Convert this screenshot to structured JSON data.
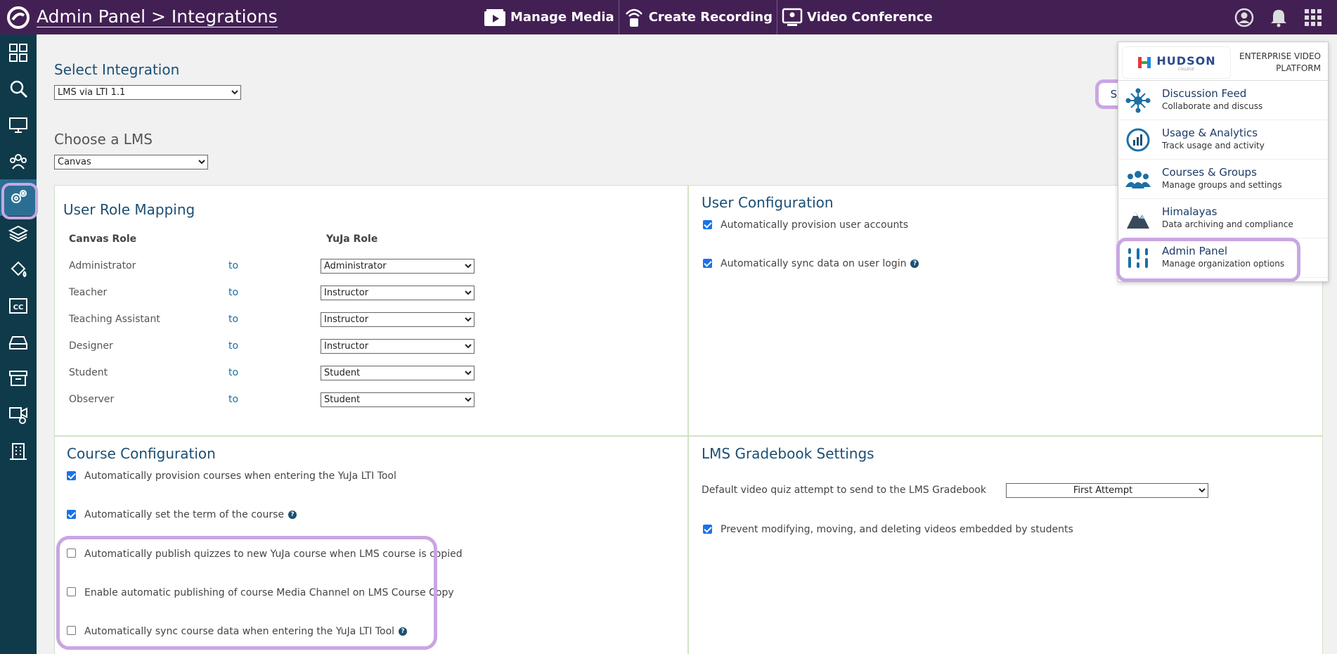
{
  "header": {
    "title": "Admin Panel > Integrations",
    "nav": [
      {
        "label": "Manage Media",
        "icon": "media-play-icon"
      },
      {
        "label": "Create Recording",
        "icon": "recording-icon"
      },
      {
        "label": "Video Conference",
        "icon": "video-conference-icon"
      }
    ]
  },
  "sidebar": {
    "items": [
      {
        "icon": "dashboard-grid-icon"
      },
      {
        "icon": "search-icon"
      },
      {
        "icon": "monitor-icon"
      },
      {
        "icon": "group-icon"
      },
      {
        "icon": "settings-gears-icon",
        "active": true
      },
      {
        "icon": "layers-icon"
      },
      {
        "icon": "paint-bucket-icon"
      },
      {
        "icon": "closed-caption-icon"
      },
      {
        "icon": "storage-drive-icon"
      },
      {
        "icon": "archive-box-icon"
      },
      {
        "icon": "video-camera-icon"
      },
      {
        "icon": "building-icon"
      }
    ]
  },
  "main": {
    "select_integration_label": "Select Integration",
    "select_integration_value": "LMS via LTI 1.1",
    "choose_lms_label": "Choose a LMS",
    "choose_lms_value": "Canvas",
    "save_label": "Save"
  },
  "role_mapping": {
    "title": "User Role Mapping",
    "col_lms": "Canvas Role",
    "col_yuja": "YuJa Role",
    "to_label": "to",
    "rows": [
      {
        "lms": "Administrator",
        "yuja": "Administrator"
      },
      {
        "lms": "Teacher",
        "yuja": "Instructor"
      },
      {
        "lms": "Teaching Assistant",
        "yuja": "Instructor"
      },
      {
        "lms": "Designer",
        "yuja": "Instructor"
      },
      {
        "lms": "Student",
        "yuja": "Student"
      },
      {
        "lms": "Observer",
        "yuja": "Student"
      }
    ]
  },
  "user_config": {
    "title": "User Configuration",
    "options": [
      {
        "label": "Automatically provision user accounts",
        "checked": true,
        "help": false
      },
      {
        "label": "Automatically sync data on user login",
        "checked": true,
        "help": true
      }
    ]
  },
  "course_config": {
    "title": "Course Configuration",
    "options": [
      {
        "label": "Automatically provision courses when entering the YuJa LTI Tool",
        "checked": true,
        "help": false
      },
      {
        "label": "Automatically set the term of the course",
        "checked": true,
        "help": true
      },
      {
        "label": "Automatically publish quizzes to new YuJa course when LMS course is copied",
        "checked": false,
        "help": false
      },
      {
        "label": "Enable automatic publishing of course Media Channel on LMS Course Copy",
        "checked": false,
        "help": false
      },
      {
        "label": "Automatically sync course data when entering the YuJa LTI Tool",
        "checked": false,
        "help": true
      }
    ]
  },
  "gradebook": {
    "title": "LMS Gradebook Settings",
    "quiz_attempt_label": "Default video quiz attempt to send to the LMS Gradebook",
    "quiz_attempt_value": "First Attempt",
    "prevent_label": "Prevent modifying, moving, and deleting videos embedded by students",
    "prevent_checked": true
  },
  "app_menu": {
    "brand_name": "HUDSON",
    "brand_sub": "COLLEGE",
    "brand_tagline": "ENTERPRISE VIDEO PLATFORM",
    "items": [
      {
        "title": "Discussion Feed",
        "subtitle": "Collaborate and discuss",
        "icon": "discussion-network-icon"
      },
      {
        "title": "Usage & Analytics",
        "subtitle": "Track usage and activity",
        "icon": "analytics-chart-icon"
      },
      {
        "title": "Courses & Groups",
        "subtitle": "Manage groups and settings",
        "icon": "people-group-icon"
      },
      {
        "title": "Himalayas",
        "subtitle": "Data archiving and compliance",
        "icon": "mountain-icon"
      },
      {
        "title": "Admin Panel",
        "subtitle": "Manage organization options",
        "icon": "sliders-icon"
      }
    ]
  },
  "colors": {
    "header_bg": "#432054",
    "sidebar_bg": "#0f3a4a",
    "highlight": "#c9a6e2",
    "accent_text": "#1c4f74"
  }
}
